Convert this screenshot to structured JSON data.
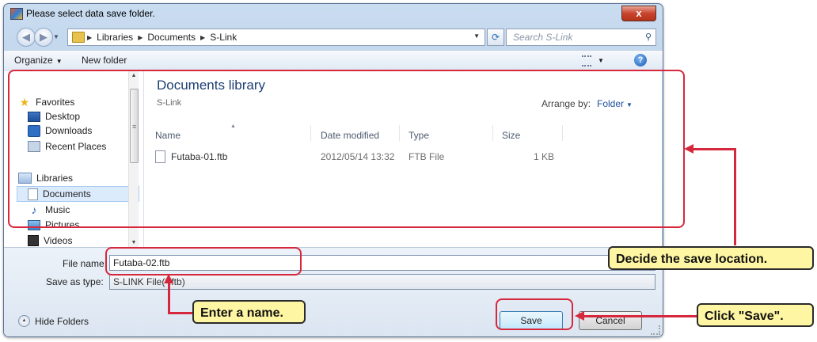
{
  "window": {
    "title": "Please select data save folder.",
    "close_label": "x"
  },
  "address": {
    "crumbs": [
      "Libraries",
      "Documents",
      "S-Link"
    ],
    "search_placeholder": "Search S-Link"
  },
  "toolbar": {
    "organize": "Organize",
    "new_folder": "New folder"
  },
  "nav": {
    "favorites": "Favorites",
    "desktop": "Desktop",
    "downloads": "Downloads",
    "recent_places": "Recent Places",
    "libraries": "Libraries",
    "documents": "Documents",
    "music": "Music",
    "pictures": "Pictures",
    "videos": "Videos"
  },
  "content": {
    "library_title": "Documents library",
    "library_subtitle": "S-Link",
    "arrange_label": "Arrange by:",
    "arrange_value": "Folder",
    "columns": [
      "Name",
      "Date modified",
      "Type",
      "Size"
    ],
    "files": [
      {
        "name": "Futaba-01.ftb",
        "date": "2012/05/14 13:32",
        "type": "FTB File",
        "size": "1 KB"
      }
    ]
  },
  "form": {
    "file_name_label": "File name:",
    "file_name_value": "Futaba-02.ftb",
    "save_type_label": "Save as type:",
    "save_type_value": "S-LINK File(*.ftb)",
    "hide_folders": "Hide Folders",
    "save_button": "Save",
    "cancel_button": "Cancel"
  },
  "callouts": {
    "location": "Decide the save location.",
    "name": "Enter a name.",
    "save": "Click \"Save\"."
  },
  "colors": {
    "annotation_red": "#d6283c",
    "callout_fill": "#fff6a3",
    "titlebar": "#b3cbe6"
  }
}
